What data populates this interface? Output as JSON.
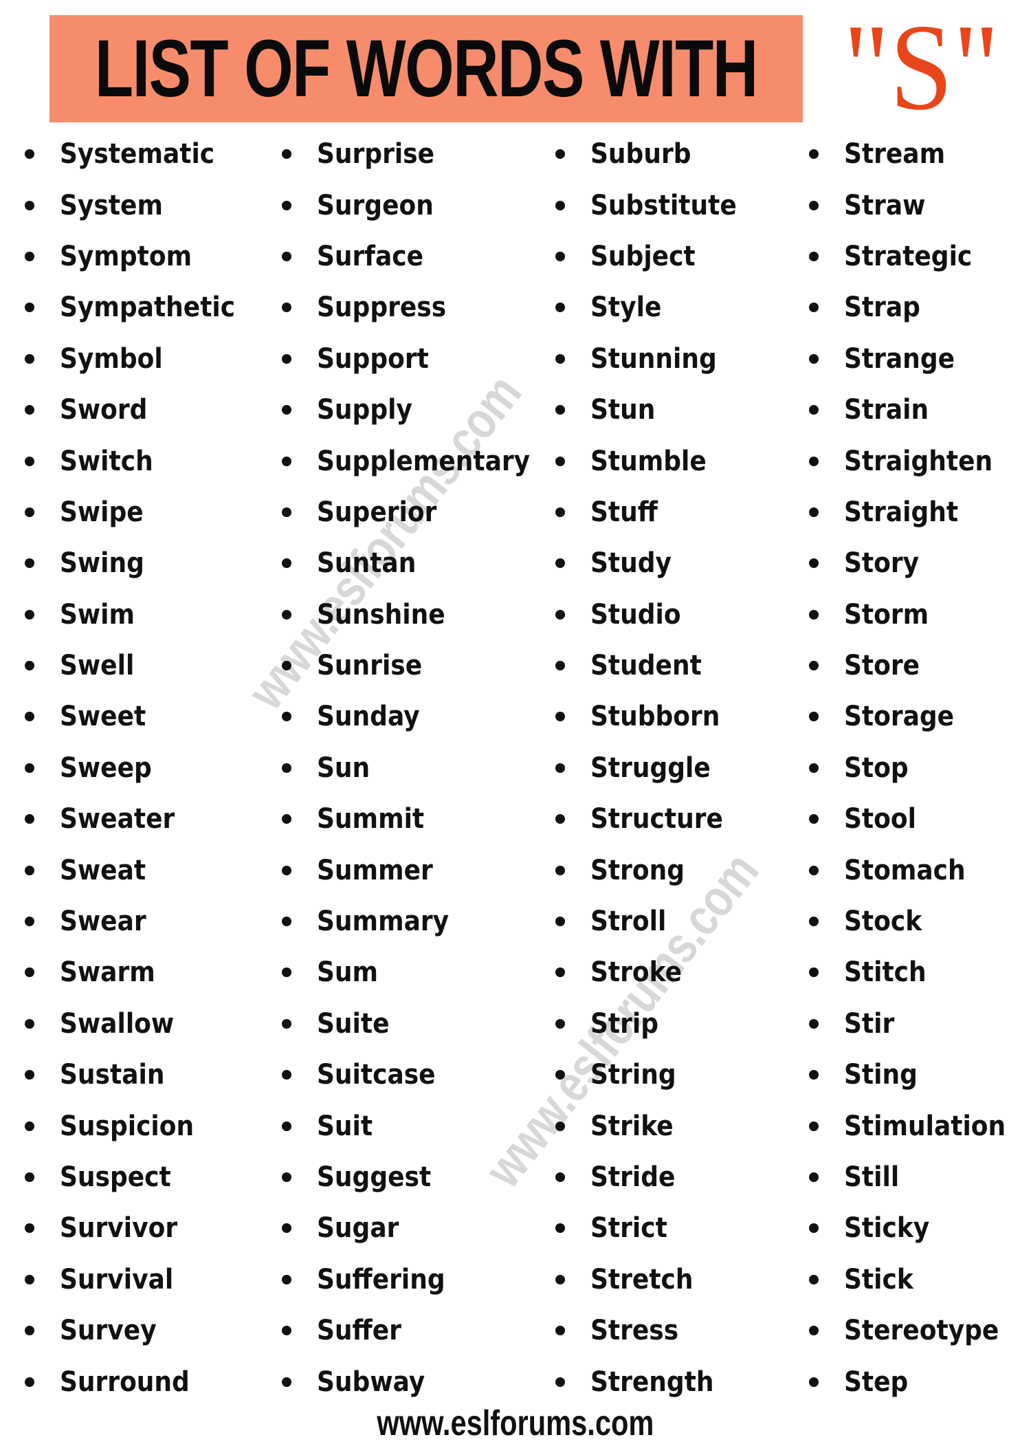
{
  "header": {
    "title": "LIST OF WORDS WITH",
    "letter": "\"S\"",
    "box_color": "#f78c6c",
    "letter_color": "#e8461a"
  },
  "watermark": "www.eslforums.com",
  "columns": [
    [
      "Systematic",
      "System",
      "Symptom",
      "Sympathetic",
      "Symbol",
      "Sword",
      "Switch",
      "Swipe",
      "Swing",
      "Swim",
      "Swell",
      "Sweet",
      "Sweep",
      "Sweater",
      "Sweat",
      "Swear",
      "Swarm",
      "Swallow",
      "Sustain",
      "Suspicion",
      "Suspect",
      "Survivor",
      "Survival",
      "Survey",
      "Surround"
    ],
    [
      "Surprise",
      "Surgeon",
      "Surface",
      "Suppress",
      "Support",
      "Supply",
      "Supplementary",
      "Superior",
      "Suntan",
      "Sunshine",
      "Sunrise",
      "Sunday",
      "Sun",
      "Summit",
      "Summer",
      "Summary",
      "Sum",
      "Suite",
      "Suitcase",
      "Suit",
      "Suggest",
      "Sugar",
      "Suffering",
      "Suffer",
      "Subway"
    ],
    [
      "Suburb",
      "Substitute",
      "Subject",
      "Style",
      "Stunning",
      "Stun",
      "Stumble",
      "Stuff",
      "Study",
      "Studio",
      "Student",
      "Stubborn",
      "Struggle",
      "Structure",
      "Strong",
      "Stroll",
      "Stroke",
      "Strip",
      "String",
      "Strike",
      "Stride",
      "Strict",
      "Stretch",
      "Stress",
      "Strength"
    ],
    [
      "Stream",
      "Straw",
      "Strategic",
      "Strap",
      "Strange",
      "Strain",
      "Straighten",
      "Straight",
      "Story",
      "Storm",
      "Store",
      "Storage",
      "Stop",
      "Stool",
      "Stomach",
      "Stock",
      "Stitch",
      "Stir",
      "Sting",
      "Stimulation",
      "Still",
      "Sticky",
      "Stick",
      "Stereotype",
      "Step"
    ]
  ],
  "footer": "www.eslforums.com"
}
